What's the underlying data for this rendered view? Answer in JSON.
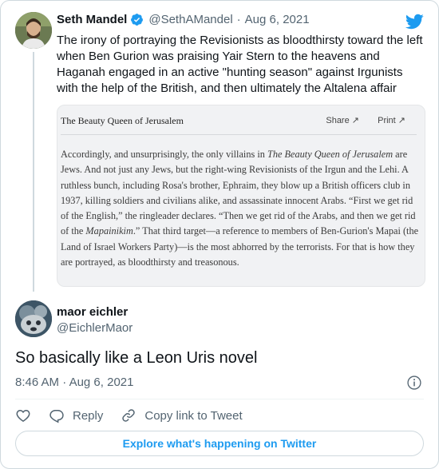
{
  "parent_tweet": {
    "author_name": "Seth Mandel",
    "handle": "@SethAMandel",
    "separator": "·",
    "date": "Aug 6, 2021",
    "text": "The irony of portraying the Revisionists as bloodthirsty toward the left when Ben Gurion was praising Yair Stern to the heavens and Haganah engaged in an active \"hunting season\" against Irgunists with the help of the British, and then ultimately the Altalena affair",
    "card": {
      "title": "The Beauty Queen of Jerusalem",
      "share_label": "Share ↗",
      "print_label": "Print ↗",
      "text_html": "Accordingly, and unsurprisingly, the only villains in <i>The Beauty Queen of Jerusalem</i> are Jews. And not just any Jews, but the right-wing Revisionists of the Irgun and the Lehi. A ruthless bunch, including Rosa's brother, Ephraim, they blow up a British officers club in 1937, killing soldiers and civilians alike, and assassinate innocent Arabs. “First we get rid of the English,” the ringleader declares. “Then we get rid of the Arabs, and then we get rid of the <i>Mapainikim</i>.” That third target—a reference to members of Ben-Gurion's Mapai (the Land of Israel Workers Party)—is the most abhorred by the terrorists. For that is how they are portrayed, as bloodthirsty and treasonous."
    }
  },
  "tweet": {
    "author_name": "maor eichler",
    "handle": "@EichlerMaor",
    "text": "So basically like a Leon Uris novel",
    "time": "8:46 AM",
    "separator": "·",
    "date": "Aug 6, 2021"
  },
  "actions": {
    "reply_label": "Reply",
    "copy_label": "Copy link to Tweet"
  },
  "explore_label": "Explore what's happening on Twitter",
  "colors": {
    "accent": "#1d9bf0",
    "text": "#0f1419",
    "muted": "#536471",
    "border": "#cfd9de"
  }
}
